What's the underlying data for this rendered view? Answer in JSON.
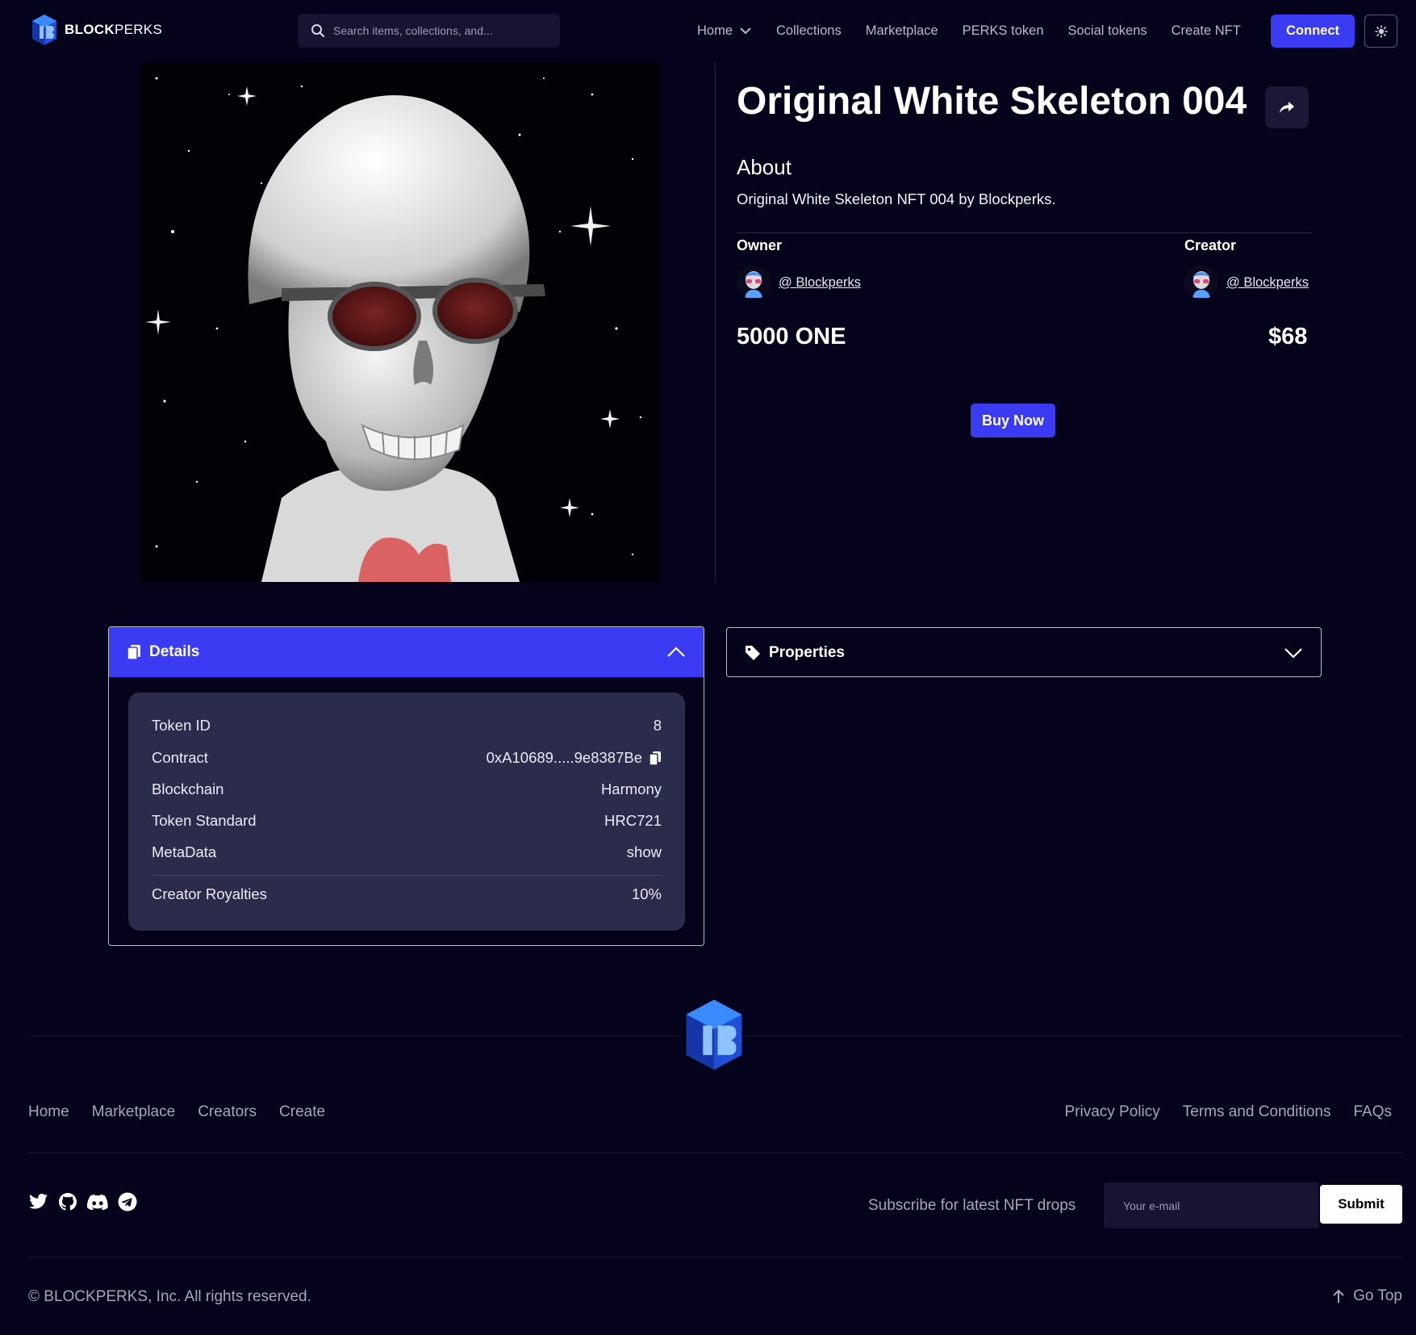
{
  "header": {
    "brand_bold": "BLOCK",
    "brand_light": "PERKS",
    "search_placeholder": "Search items, collections, and...",
    "nav": [
      {
        "label": "Home",
        "icon": "chevron-down-icon"
      },
      {
        "label": "Collections"
      },
      {
        "label": "Marketplace"
      },
      {
        "label": "PERKS token"
      },
      {
        "label": "Social tokens"
      },
      {
        "label": "Create NFT"
      }
    ],
    "connect_label": "Connect",
    "theme_icon": "sun-icon"
  },
  "nft": {
    "title": "Original White Skeleton 004",
    "about_heading": "About",
    "about_text": "Original White Skeleton NFT 004 by Blockperks.",
    "owner_heading": "Owner",
    "owner_name": "@ Blockperks",
    "creator_heading": "Creator",
    "creator_name": "@ Blockperks",
    "price_native": "5000 ONE",
    "price_usd": "$68",
    "buy_label": "Buy Now"
  },
  "details": {
    "heading": "Details",
    "rows": [
      {
        "label": "Token ID",
        "value": "8"
      },
      {
        "label": "Contract",
        "value": "0xA10689.....9e8387Be",
        "icon": "copy-icon"
      },
      {
        "label": "Blockchain",
        "value": "Harmony"
      },
      {
        "label": "Token Standard",
        "value": "HRC721"
      },
      {
        "label": "MetaData",
        "value": "show"
      },
      {
        "label": "Creator Royalties",
        "value": "10%"
      }
    ]
  },
  "properties": {
    "heading": "Properties"
  },
  "footer": {
    "links_left": [
      "Home",
      "Marketplace",
      "Creators",
      "Create"
    ],
    "links_right": [
      "Privacy Policy",
      "Terms and Conditions",
      "FAQs"
    ],
    "socials": [
      "twitter-icon",
      "github-icon",
      "discord-icon",
      "telegram-icon"
    ],
    "subscribe_label": "Subscribe for latest NFT drops",
    "email_placeholder": "Your e-mail",
    "submit_label": "Submit",
    "copyright": "© BLOCKPERKS, Inc. All rights reserved.",
    "gotop_label": "Go Top"
  },
  "colors": {
    "background": "#05031c",
    "accent": "#3b3bf4",
    "card": "#2b2b4c",
    "muted_text": "#a7a7b8"
  }
}
